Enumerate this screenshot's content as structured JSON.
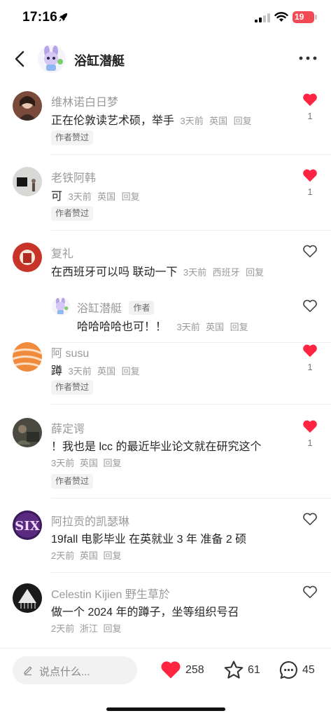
{
  "status_bar": {
    "time": "17:16",
    "battery": "19"
  },
  "nav": {
    "title": "浴缸潜艇"
  },
  "comments": [
    {
      "username": "维林诺白日梦",
      "content": "正在伦敦读艺术硕，举手",
      "time": "3天前",
      "location": "英国",
      "reply": "回复",
      "badge": "作者赞过",
      "liked": true,
      "likes": "1"
    },
    {
      "username": "老铁阿韩",
      "content": "可",
      "time": "3天前",
      "location": "英国",
      "reply": "回复",
      "badge": "作者赞过",
      "liked": true,
      "likes": "1"
    },
    {
      "username": "复礼",
      "content": "在西班牙可以吗 联动一下",
      "time": "3天前",
      "location": "西班牙",
      "reply": "回复",
      "liked": false,
      "sub_reply": {
        "username": "浴缸潜艇",
        "author_tag": "作者",
        "content": "哈哈哈哈也可！！",
        "time": "3天前",
        "location": "英国",
        "reply": "回复"
      }
    },
    {
      "username": "阿 susu",
      "content": "蹲",
      "time": "3天前",
      "location": "英国",
      "reply": "回复",
      "badge": "作者赞过",
      "liked": true,
      "likes": "1"
    },
    {
      "username": "薛定谔",
      "content": "！我也是 lcc 的最近毕业论文就在研究这个",
      "time": "3天前",
      "location": "英国",
      "reply": "回复",
      "badge": "作者赞过",
      "liked": true,
      "likes": "1"
    },
    {
      "username": "阿拉贡的凯瑟琳",
      "content": "19fall 电影毕业 在英就业 3 年 准备 2 硕",
      "time": "2天前",
      "location": "英国",
      "reply": "回复",
      "liked": false
    },
    {
      "username": "Celestin Kijien 野生草於",
      "content": "做一个 2024 年的蹲子，坐等组织号召",
      "time": "2天前",
      "location": "浙江",
      "reply": "回复",
      "liked": false
    }
  ],
  "avatar_text": {
    "six": "SIX"
  },
  "bottom_bar": {
    "placeholder": "说点什么...",
    "likes": "258",
    "stars": "61",
    "comments": "45"
  },
  "colors": {
    "like_red": "#ff2442",
    "icon_gray": "#333333"
  }
}
